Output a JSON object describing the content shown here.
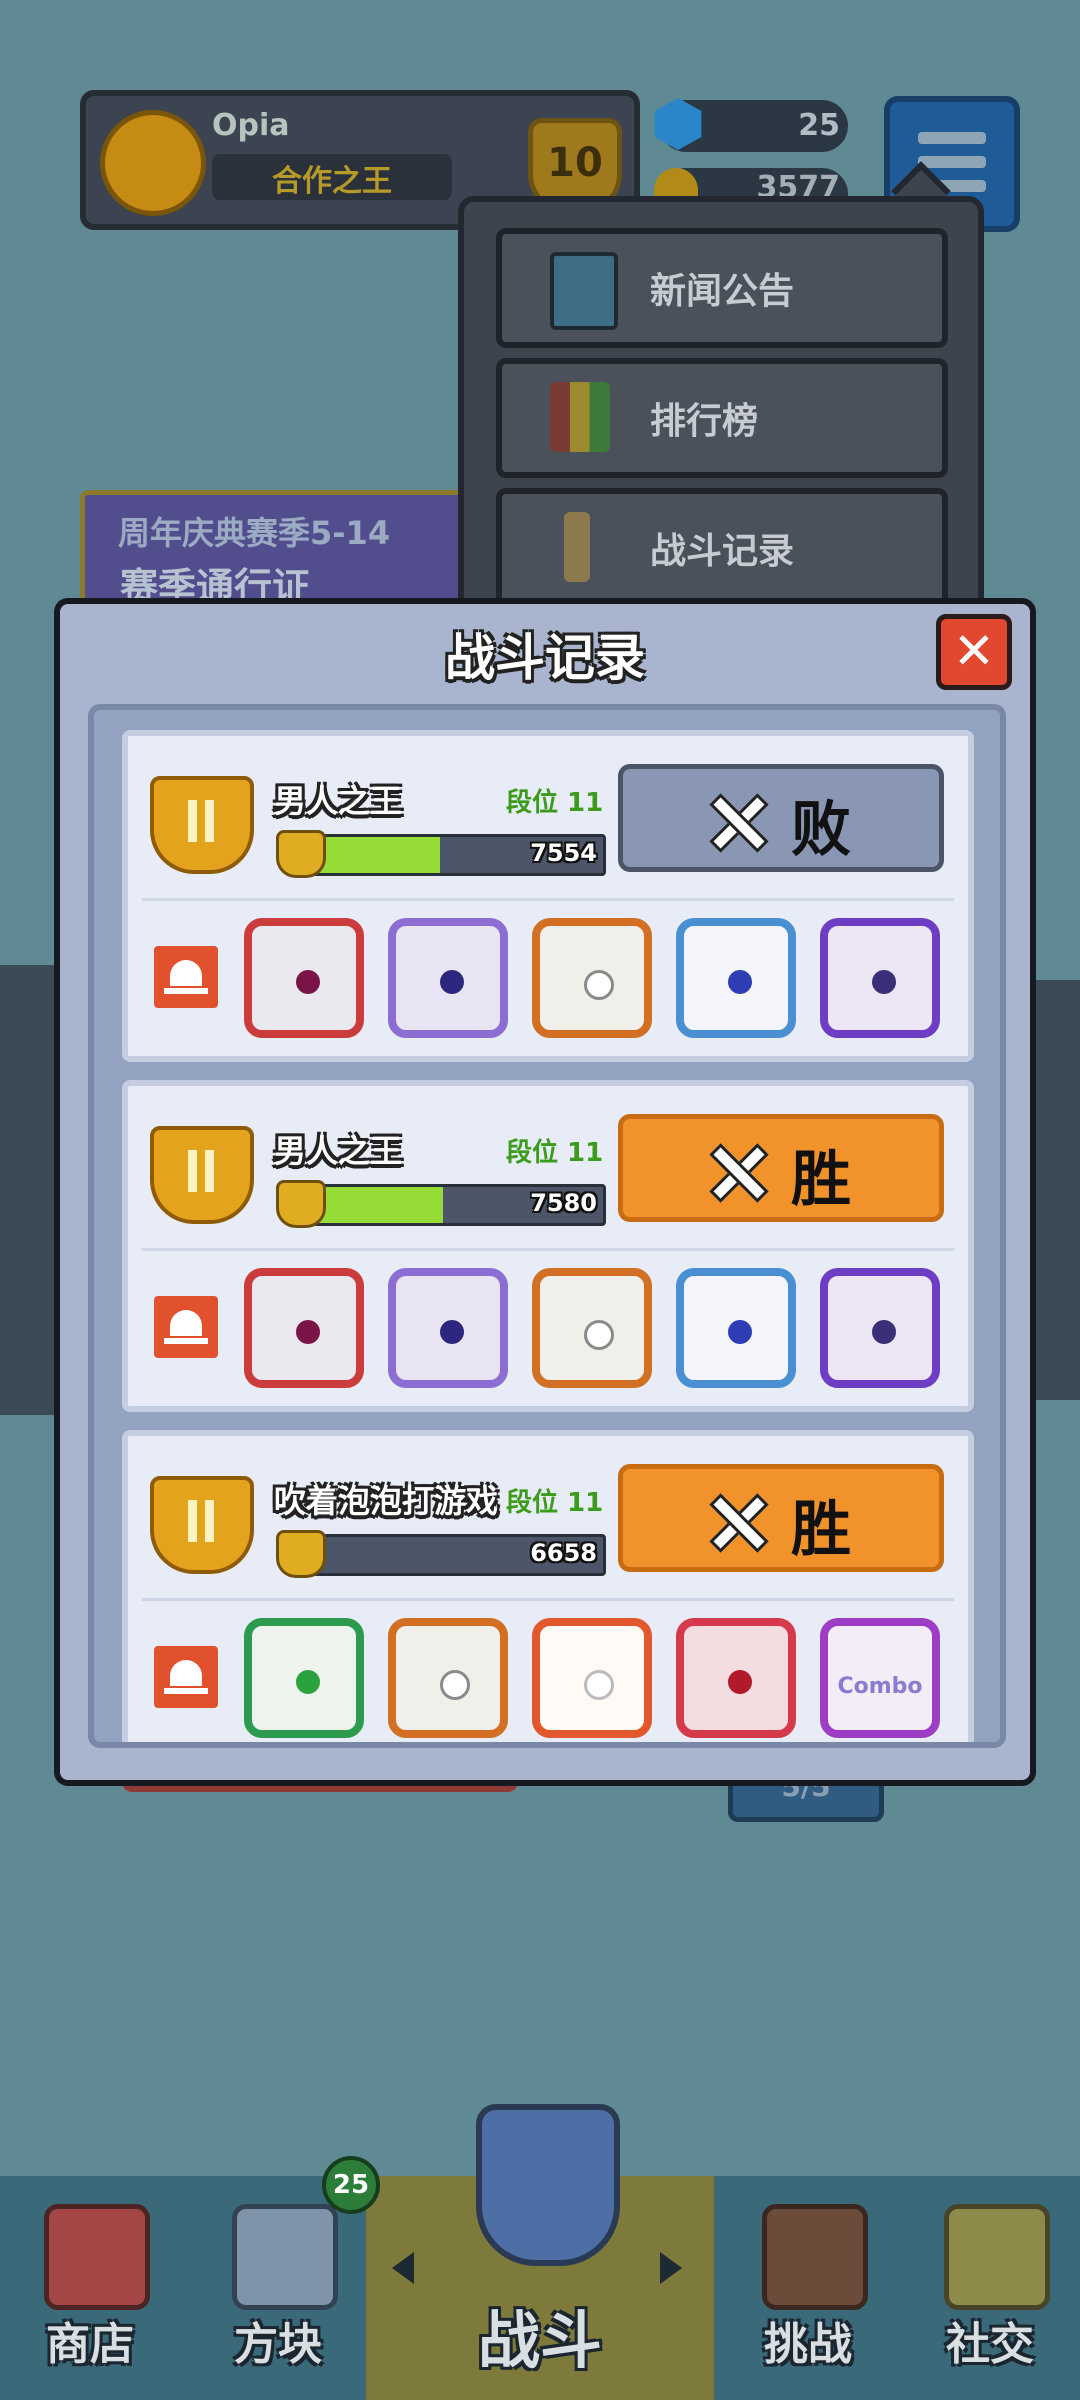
{
  "profile": {
    "name": "Opia",
    "title": "合作之王",
    "rank_badge": "10"
  },
  "currency": {
    "gems": "25",
    "gold": "3577"
  },
  "dropdown_menu": {
    "items": [
      {
        "label": "新闻公告",
        "icon": "monitor-icon"
      },
      {
        "label": "排行榜",
        "icon": "leaderboard-icon"
      },
      {
        "label": "战斗记录",
        "icon": "sword-icon"
      }
    ]
  },
  "background": {
    "season_line1": "周年庆典赛季5-14",
    "season_line2": "赛季通行证",
    "count_pill": "5/5"
  },
  "modal": {
    "title": "战斗记录",
    "close_icon": "close-icon",
    "records": [
      {
        "player": "男人之王",
        "rank_label": "段位 11",
        "trophies": "7554",
        "trophy_progress": 0.45,
        "result": "败",
        "result_type": "loss",
        "dice": [
          "d0",
          "d1",
          "d2",
          "d3",
          "d4"
        ]
      },
      {
        "player": "男人之王",
        "rank_label": "段位 11",
        "trophies": "7580",
        "trophy_progress": 0.46,
        "result": "胜",
        "result_type": "win",
        "dice": [
          "d0",
          "d1",
          "d2",
          "d3",
          "d4"
        ]
      },
      {
        "player": "吹着泡泡打游戏",
        "rank_label": "段位 11",
        "trophies": "6658",
        "trophy_progress": 0.04,
        "result": "胜",
        "result_type": "win",
        "dice": [
          "g0",
          "d2",
          "g2",
          "g3",
          "g4"
        ],
        "combo_text": "Combo"
      }
    ]
  },
  "bottom_nav": {
    "items": [
      {
        "label": "商店",
        "icon": "shop-icon"
      },
      {
        "label": "方块",
        "icon": "dice-box-icon",
        "badge": "25"
      },
      {
        "label": "战斗",
        "icon": "shield-sword-icon"
      },
      {
        "label": "挑战",
        "icon": "challenge-icon"
      },
      {
        "label": "社交",
        "icon": "social-icon"
      }
    ]
  }
}
